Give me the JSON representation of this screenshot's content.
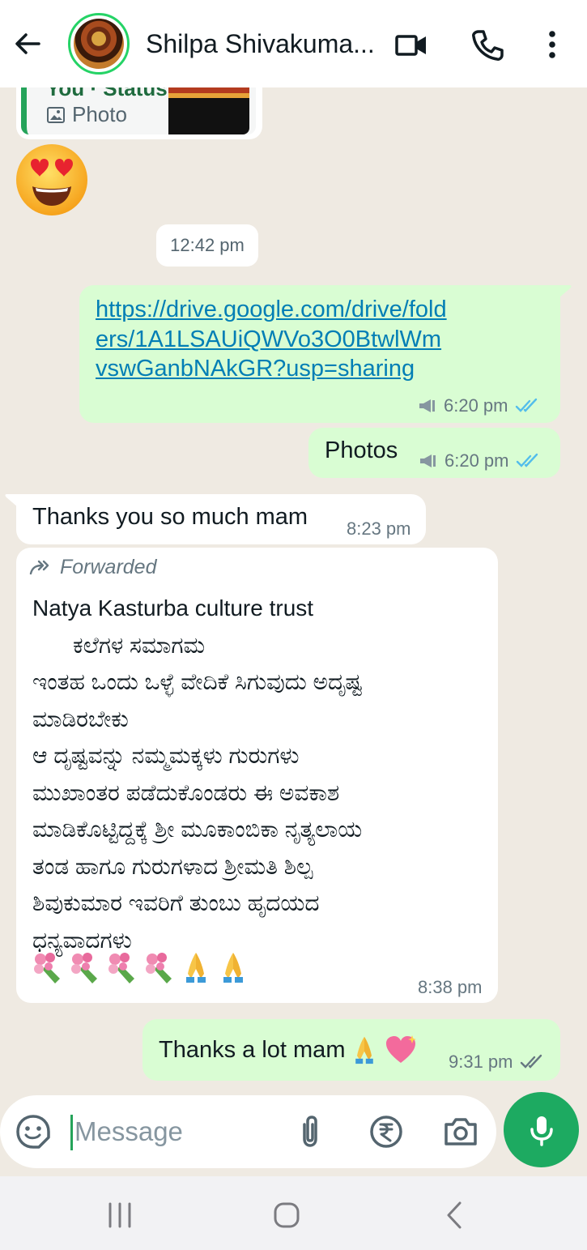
{
  "header": {
    "contact_name": "Shilpa Shivakuma...",
    "icons": [
      "back-arrow-icon",
      "video-call-icon",
      "voice-call-icon",
      "more-options-icon"
    ]
  },
  "reply_preview": {
    "title": "You · Status",
    "type_label": "Photo"
  },
  "date_chip": "12:42 pm",
  "messages": [
    {
      "direction": "out",
      "text": "https://drive.google.com/drive/folders/1A1LSAUiQWVo3O0BtwlWmvswGanbNAkGR?usp=sharing",
      "time": "6:20 pm",
      "status": "read"
    },
    {
      "direction": "out",
      "text": "Photos",
      "time": "6:20 pm",
      "status": "read"
    },
    {
      "direction": "in",
      "text": "Thanks you so much mam",
      "time": "8:23 pm"
    },
    {
      "direction": "in",
      "forwarded_label": "Forwarded",
      "lines": [
        "Natya Kasturba culture trust",
        "ಕಲೆಗಳ ಸಮಾಗಮ",
        "ಇಂತಹ ಒಂದು ಒಳ್ಳೆ ವೇದಿಕೆ ಸಿಗುವುದು ಅದೃಷ್ಟ",
        "ಮಾಡಿರಬೇಕು",
        "ಆ ದೃಷ್ಟವನ್ನು ನಮ್ಮಮಕ್ಕಳು ಗುರುಗಳು",
        "ಮುಖಾಂತರ ಪಡೆದುಕೊಂಡರು ಈ ಅವಕಾಶ",
        "ಮಾಡಿಕೊಟ್ಟಿದ್ದಕ್ಕೆ ಶ್ರೀ ಮೂಕಾಂಬಿಕಾ ನೃತ್ಯಲಾಯ",
        "ತಂಡ ಹಾಗೂ ಗುರುಗಳಾದ ಶ್ರೀಮತಿ ಶಿಲ್ಪ",
        "ಶಿವುಕುಮಾರ  ಇವರಿಗೆ ತುಂಬು ಹೃದಯದ",
        "ಧನ್ಯವಾದಗಳು"
      ],
      "emojis": [
        "bouquet",
        "bouquet",
        "bouquet",
        "bouquet",
        "folded-hands",
        "folded-hands"
      ],
      "time": "8:38 pm"
    },
    {
      "direction": "out",
      "text": "Thanks a lot mam",
      "emojis": [
        "folded-hands",
        "sparkling-heart"
      ],
      "time": "9:31 pm",
      "status": "delivered"
    }
  ],
  "composer": {
    "placeholder": "Message",
    "icons": [
      "emoji-icon",
      "attach-icon",
      "rupee-payment-icon",
      "camera-icon",
      "mic-icon"
    ]
  },
  "colors": {
    "outgoing_bubble": "#d9fdd3",
    "incoming_bubble": "#ffffff",
    "chat_background": "#efeae2",
    "accent_green": "#1daa61",
    "link": "#027eb5",
    "read_ticks": "#53bdeb"
  }
}
